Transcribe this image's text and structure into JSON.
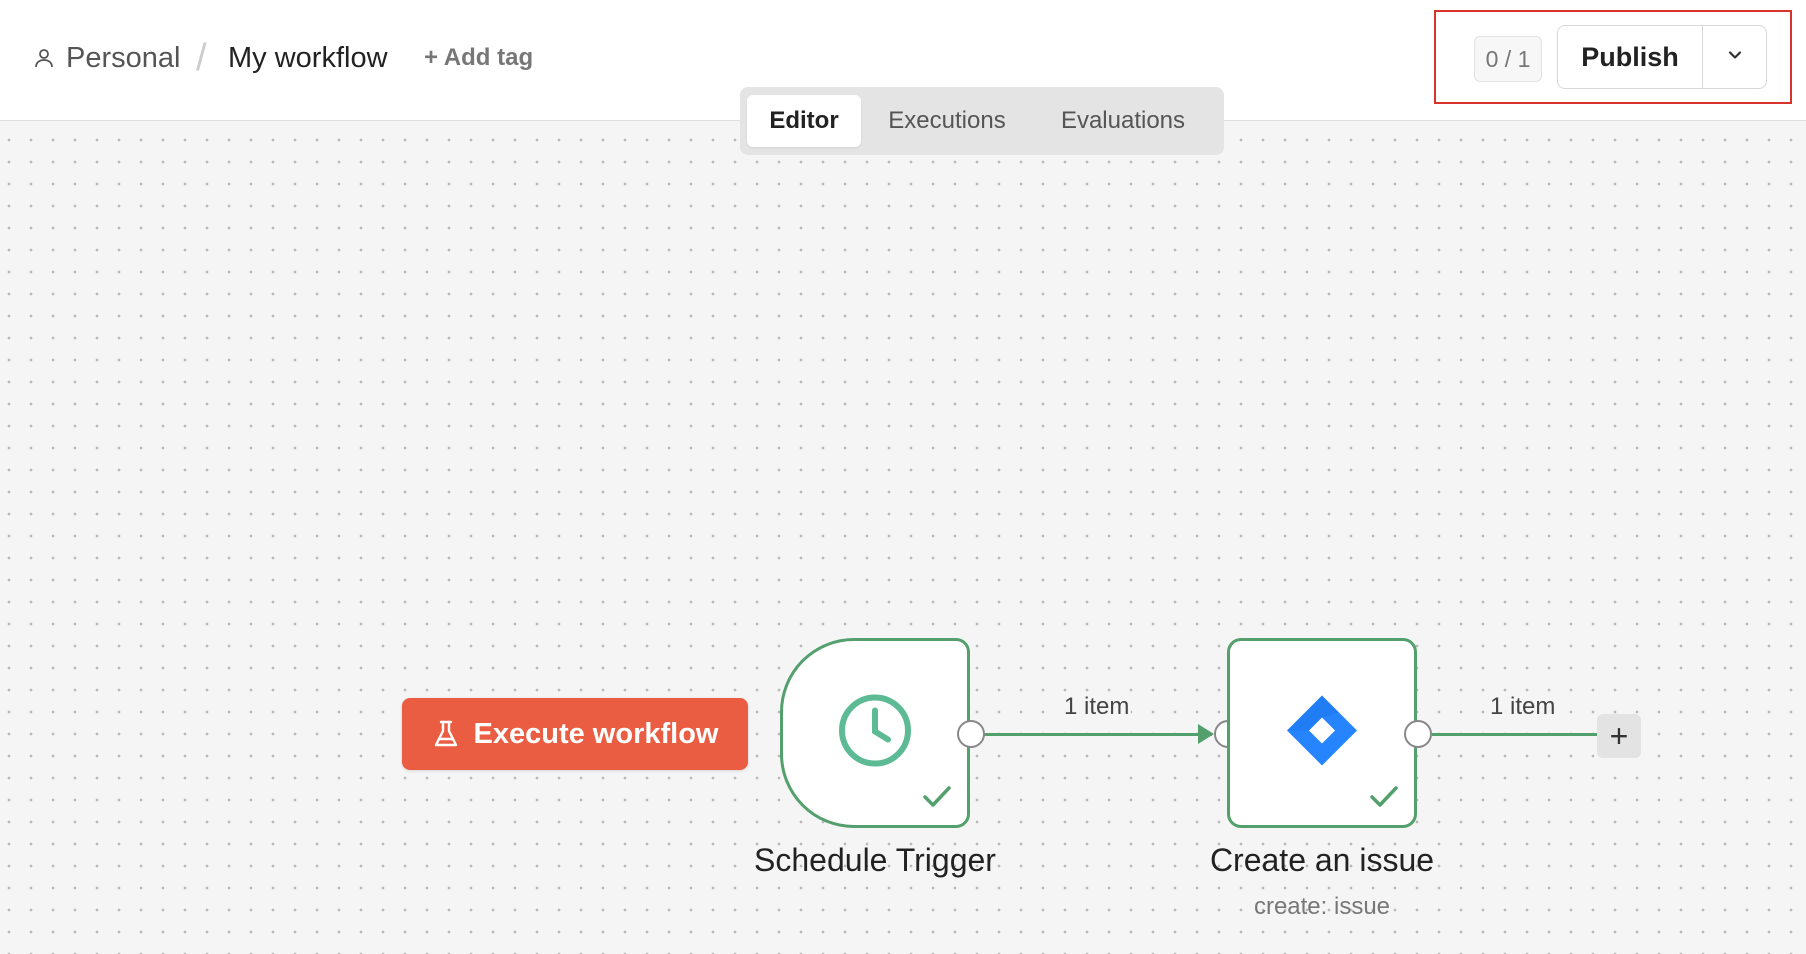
{
  "header": {
    "breadcrumb": {
      "project": "Personal",
      "separator": "/",
      "workflow": "My workflow"
    },
    "add_tag": "+ Add tag",
    "counter": "0 / 1",
    "publish_label": "Publish"
  },
  "tabs": [
    {
      "label": "Editor",
      "active": true
    },
    {
      "label": "Executions",
      "active": false
    },
    {
      "label": "Evaluations",
      "active": false
    }
  ],
  "canvas": {
    "execute_button": "Execute workflow",
    "nodes": [
      {
        "title": "Schedule Trigger",
        "subtitle": "",
        "icon": "clock-icon",
        "status": "success"
      },
      {
        "title": "Create an issue",
        "subtitle": "create: issue",
        "icon": "jira-icon",
        "status": "success"
      }
    ],
    "edge_labels": [
      "1 item",
      "1 item"
    ],
    "add_node": "+"
  },
  "colors": {
    "node_border": "#53a06d",
    "execute_button": "#ea5d42",
    "highlight_box": "#d9342b",
    "jira_blue": "#2684ff"
  }
}
